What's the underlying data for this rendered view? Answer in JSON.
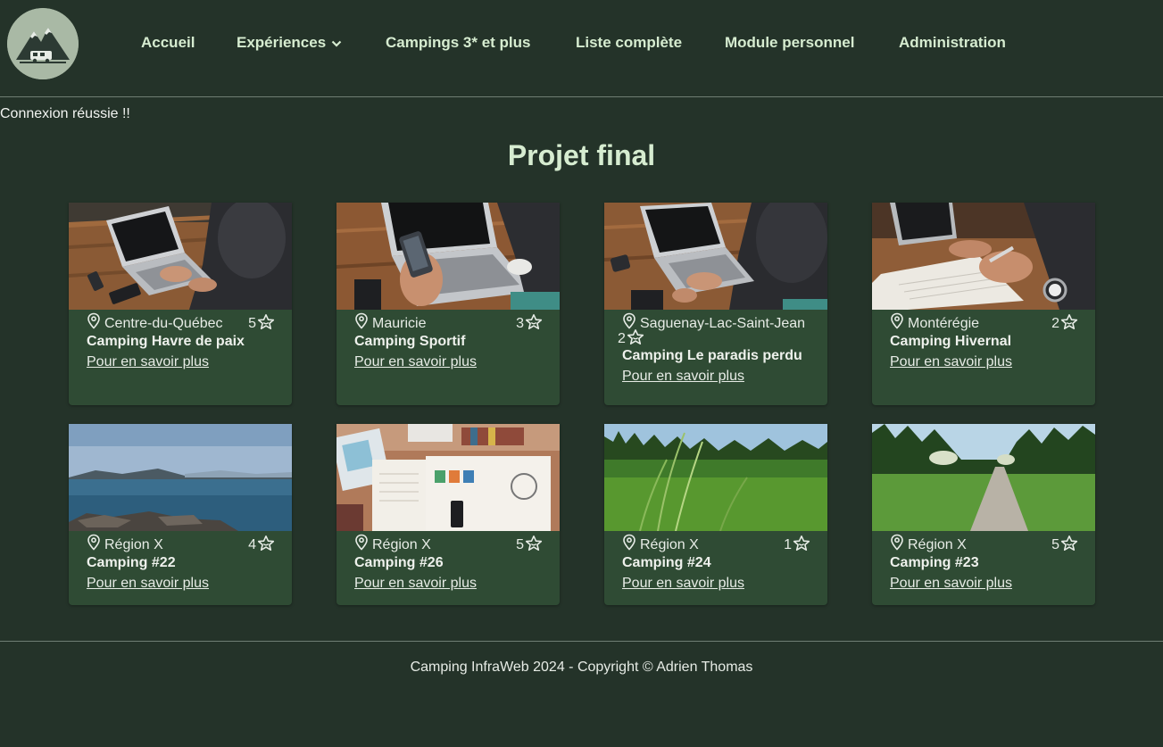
{
  "nav": {
    "items": [
      {
        "label": "Accueil"
      },
      {
        "label": "Expériences"
      },
      {
        "label": "Campings 3* et plus"
      },
      {
        "label": "Liste complète"
      },
      {
        "label": "Module personnel"
      },
      {
        "label": "Administration"
      }
    ]
  },
  "status_message": "Connexion réussie !!",
  "page_title": "Projet final",
  "cards": [
    {
      "region": "Centre-du-Québec",
      "rating": "5",
      "name": "Camping Havre de paix",
      "link": "Pour en savoir plus",
      "image": "laptop-phone-table-photo"
    },
    {
      "region": "Mauricie",
      "rating": "3",
      "name": "Camping Sportif",
      "link": "Pour en savoir plus",
      "image": "hand-phone-laptop-photo"
    },
    {
      "region": "Saguenay-Lac-Saint-Jean",
      "rating": "2",
      "name": "Camping Le paradis perdu",
      "link": "Pour en savoir plus",
      "image": "typing-laptop-photo"
    },
    {
      "region": "Montérégie",
      "rating": "2",
      "name": "Camping Hivernal",
      "link": "Pour en savoir plus",
      "image": "writing-notebook-photo"
    },
    {
      "region": "Région X",
      "rating": "4",
      "name": "Camping #22",
      "link": "Pour en savoir plus",
      "image": "lake-shore-photo"
    },
    {
      "region": "Région X",
      "rating": "5",
      "name": "Camping #26",
      "link": "Pour en savoir plus",
      "image": "desk-flatlay-photo"
    },
    {
      "region": "Région X",
      "rating": "1",
      "name": "Camping #24",
      "link": "Pour en savoir plus",
      "image": "grass-field-photo"
    },
    {
      "region": "Région X",
      "rating": "5",
      "name": "Camping #23",
      "link": "Pour en savoir plus",
      "image": "forest-path-photo"
    }
  ],
  "footer": "Camping InfraWeb 2024 - Copyright © Adrien Thomas",
  "colors": {
    "background": "#243329",
    "card": "#2f4b34",
    "nav_text": "#d6ecd0",
    "title": "#d6ecd0"
  }
}
